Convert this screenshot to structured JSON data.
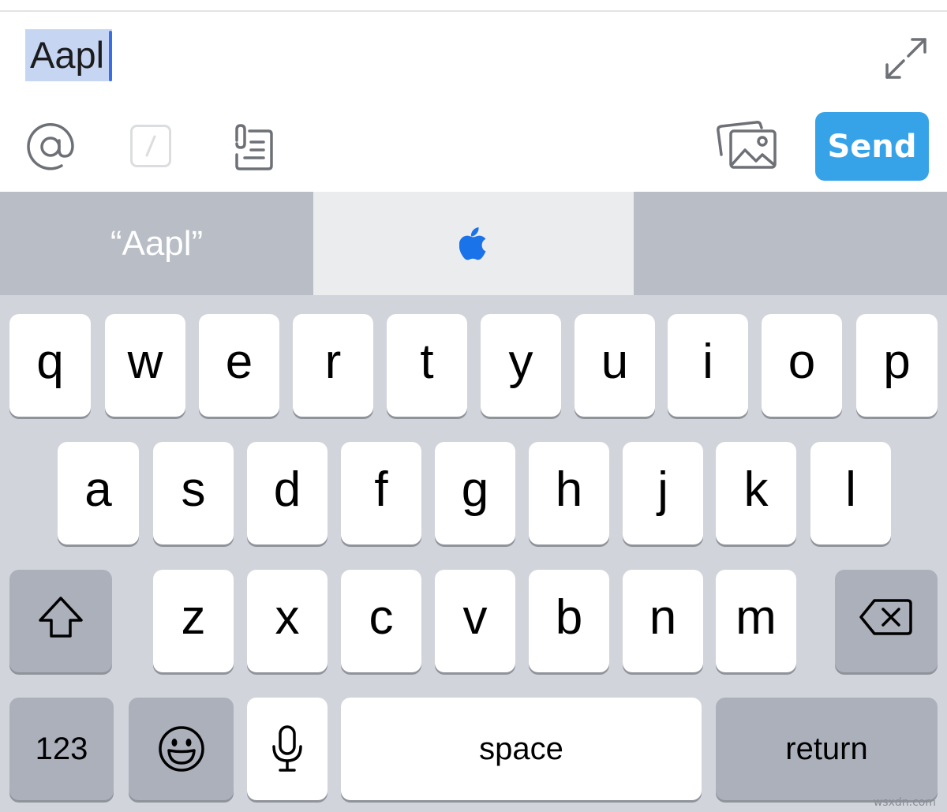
{
  "compose": {
    "text": "Aapl"
  },
  "toolbar": {
    "send_label": "Send",
    "icons": {
      "mention": "at-icon",
      "shortcut": "slash-icon",
      "files": "files-icon",
      "photos": "photo-icon",
      "expand": "expand-icon"
    }
  },
  "suggestions": {
    "items": [
      "“Aapl”",
      "apple-logo",
      ""
    ]
  },
  "keyboard": {
    "row1": [
      "q",
      "w",
      "e",
      "r",
      "t",
      "y",
      "u",
      "i",
      "o",
      "p"
    ],
    "row2": [
      "a",
      "s",
      "d",
      "f",
      "g",
      "h",
      "j",
      "k",
      "l"
    ],
    "row3": [
      "z",
      "x",
      "c",
      "v",
      "b",
      "n",
      "m"
    ],
    "numbers_label": "123",
    "space_label": "space",
    "return_label": "return",
    "icons": {
      "shift": "shift-icon",
      "delete": "backspace-icon",
      "emoji": "emoji-icon",
      "dictation": "microphone-icon"
    }
  },
  "watermark": "wsxdn.com",
  "colors": {
    "send_button": "#36a3e9",
    "apple_logo": "#1a73e8",
    "selection": "#c6d6f2",
    "cursor": "#3a6ee8"
  }
}
